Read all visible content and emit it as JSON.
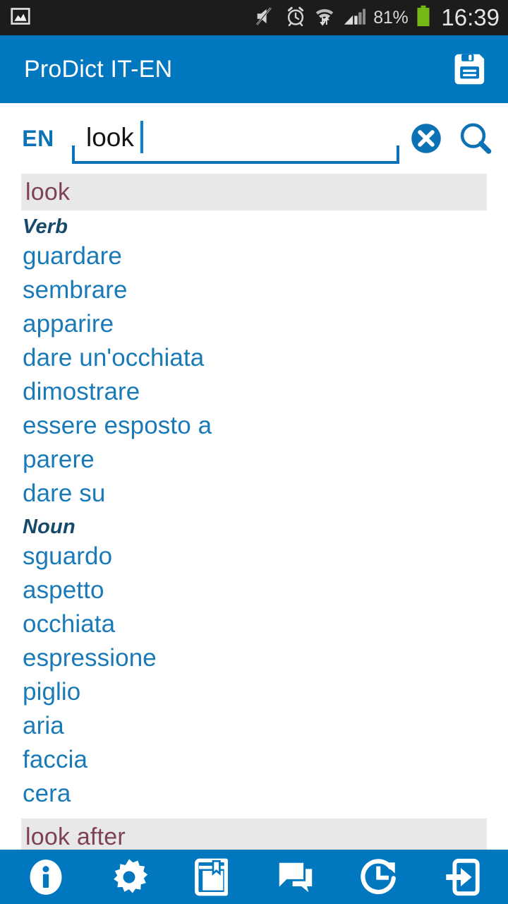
{
  "status_bar": {
    "notification_icon": "image-icon",
    "icons": [
      "volume-muted-icon",
      "alarm-clock-icon",
      "wifi-transfer-icon",
      "signal-bars-icon"
    ],
    "battery_percent": "81%",
    "battery_icon": "battery-icon",
    "battery_color": "#74b816",
    "time": "16:39"
  },
  "app_bar": {
    "title": "ProDict IT-EN",
    "save_icon": "save-icon",
    "background_color": "#0077bf"
  },
  "search": {
    "language_tag": "EN",
    "query": "look",
    "placeholder": "",
    "clear_icon": "clear-circle-icon",
    "search_icon": "search-icon",
    "accent_color": "#0b72b5"
  },
  "results": {
    "header_text_color": "#7d4256",
    "header_bg_color": "#e8e8e8",
    "translation_color": "#1a7ab8",
    "pos_color": "#17496b",
    "entries": [
      {
        "headword": "look",
        "groups": [
          {
            "pos": "Verb",
            "translations": [
              "guardare",
              "sembrare",
              "apparire",
              "dare un'occhiata",
              "dimostrare",
              "essere esposto a",
              "parere",
              "dare su"
            ]
          },
          {
            "pos": "Noun",
            "translations": [
              "sguardo",
              "aspetto",
              "occhiata",
              "espressione",
              "piglio",
              "aria",
              "faccia",
              "cera"
            ]
          }
        ]
      },
      {
        "headword": "look after",
        "groups": []
      }
    ]
  },
  "bottom_nav": {
    "background_color": "#0077bf",
    "items": [
      {
        "name": "info",
        "icon": "info-icon"
      },
      {
        "name": "settings",
        "icon": "gear-icon"
      },
      {
        "name": "dictionary",
        "icon": "book-bookmark-icon"
      },
      {
        "name": "phrases",
        "icon": "chat-bubbles-icon"
      },
      {
        "name": "history",
        "icon": "history-clock-icon"
      },
      {
        "name": "exit",
        "icon": "exit-arrow-icon"
      }
    ]
  }
}
